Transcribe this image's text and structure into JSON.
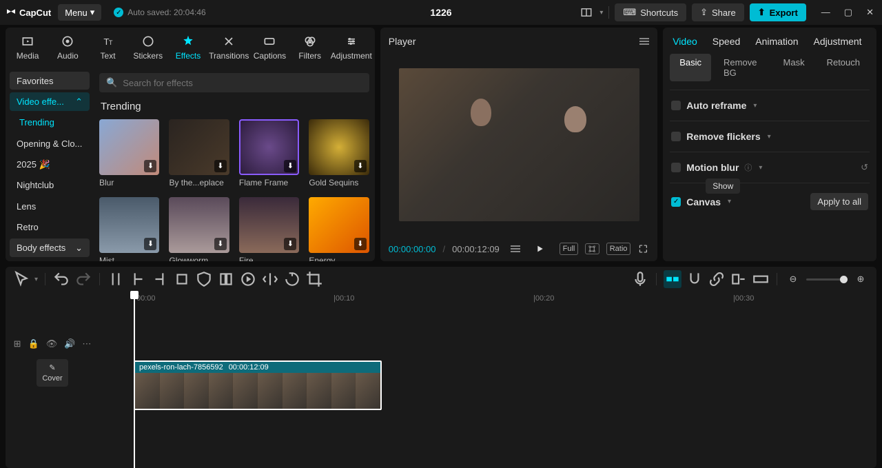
{
  "titlebar": {
    "logo": "CapCut",
    "menu": "Menu",
    "autosaved": "Auto saved: 20:04:46",
    "project": "1226",
    "shortcuts": "Shortcuts",
    "share": "Share",
    "export": "Export"
  },
  "resource_tabs": [
    {
      "id": "media",
      "label": "Media"
    },
    {
      "id": "audio",
      "label": "Audio"
    },
    {
      "id": "text",
      "label": "Text"
    },
    {
      "id": "stickers",
      "label": "Stickers"
    },
    {
      "id": "effects",
      "label": "Effects",
      "active": true
    },
    {
      "id": "transitions",
      "label": "Transitions"
    },
    {
      "id": "captions",
      "label": "Captions"
    },
    {
      "id": "filters",
      "label": "Filters"
    },
    {
      "id": "adjustment",
      "label": "Adjustment"
    }
  ],
  "sidebar": {
    "favorites": "Favorites",
    "video_effects": "Video effe...",
    "sub": [
      "Trending",
      "Opening & Clo...",
      "2025 🎉",
      "Nightclub",
      "Lens",
      "Retro"
    ],
    "body_effects": "Body effects"
  },
  "search_placeholder": "Search for effects",
  "section_title": "Trending",
  "effects": [
    {
      "name": "Blur",
      "bg": "linear-gradient(135deg,#89a8d4,#c18a7a)"
    },
    {
      "name": "By the...eplace",
      "bg": "linear-gradient(135deg,#2a2420,#4a3a2a)"
    },
    {
      "name": "Flame Frame",
      "bg": "radial-gradient(circle,#6a4a8a,#2a1a3a)",
      "flame": true
    },
    {
      "name": "Gold Sequins",
      "bg": "radial-gradient(circle,#d4af37,#3a2a0a)"
    },
    {
      "name": "Mist",
      "bg": "linear-gradient(180deg,#4a5a6a,#8a9aaa)"
    },
    {
      "name": "Glowworm",
      "bg": "linear-gradient(180deg,#5a4a5a,#aa9a9a)"
    },
    {
      "name": "Fire",
      "bg": "linear-gradient(180deg,#3a2a3a,#8a6a5a)"
    },
    {
      "name": "Energy",
      "bg": "linear-gradient(135deg,#ffaa00,#dd5500)"
    }
  ],
  "player": {
    "title": "Player",
    "current": "00:00:00:00",
    "duration": "00:00:12:09",
    "full": "Full",
    "ratio": "Ratio"
  },
  "inspector": {
    "tabs": [
      "Video",
      "Speed",
      "Animation",
      "Adjustment"
    ],
    "subtabs": [
      "Basic",
      "Remove BG",
      "Mask",
      "Retouch"
    ],
    "auto_reframe": "Auto reframe",
    "remove_flickers": "Remove flickers",
    "motion_blur": "Motion blur",
    "show_tooltip": "Show",
    "canvas": "Canvas",
    "apply_all": "Apply to all"
  },
  "timeline": {
    "cover": "Cover",
    "marks": [
      "00:00",
      "|00:10",
      "|00:20",
      "|00:30"
    ],
    "clip_name": "pexels-ron-lach-7856592",
    "clip_dur": "00:00:12:09"
  }
}
